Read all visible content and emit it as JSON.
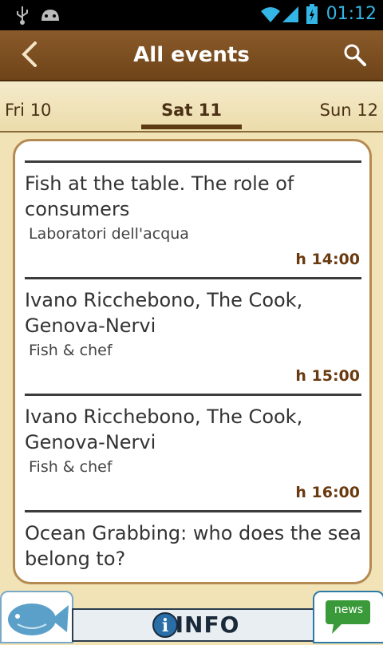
{
  "status_bar": {
    "time": "01:12"
  },
  "header": {
    "title": "All events"
  },
  "tabs": {
    "prev": "Fri 10",
    "current": "Sat 11",
    "next": "Sun 12"
  },
  "events": [
    {
      "title": "Fish at the table. The role of consumers",
      "category": "Laboratori dell'acqua",
      "time": "h 14:00"
    },
    {
      "title": "Ivano Ricchebono, The Cook, Genova-Nervi",
      "category": "Fish & chef",
      "time": "h 15:00"
    },
    {
      "title": "Ivano Ricchebono, The Cook, Genova-Nervi",
      "category": "Fish & chef",
      "time": "h 16:00"
    },
    {
      "title": "Ocean Grabbing: who does the sea belong to?",
      "category": "",
      "time": ""
    }
  ],
  "bottom_bar": {
    "info_label": "INFO",
    "news_label": "news"
  }
}
